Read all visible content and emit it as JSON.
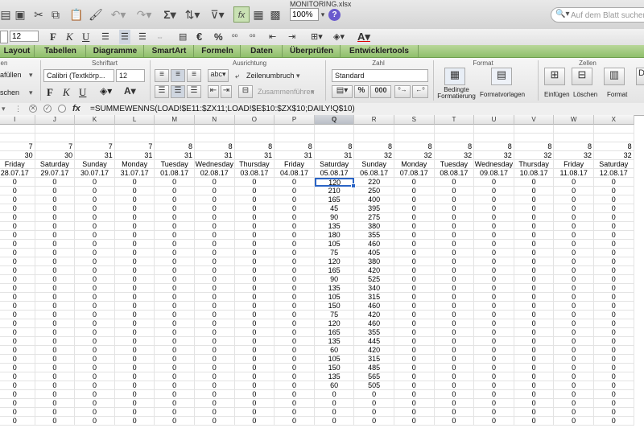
{
  "toolbar": {
    "title_fragment": "MONITORING.xlsx",
    "zoom_value": "100%",
    "search_placeholder": "Auf dem Blatt suchen"
  },
  "format_row": {
    "font_size": "12",
    "bold": "F",
    "italic": "K",
    "underline": "U"
  },
  "ribbon_tabs": [
    "Layout",
    "Tabellen",
    "Diagramme",
    "SmartArt",
    "Formeln",
    "Daten",
    "Überprüfen",
    "Entwicklertools"
  ],
  "ribbon": {
    "groups": {
      "edit_fragment": "en",
      "font": "Schriftart",
      "alignment": "Ausrichtung",
      "number": "Zahl",
      "format": "Format",
      "cells": "Zellen"
    },
    "fill_label": "afüllen",
    "clear_label": "schen",
    "font_name": "Calibri (Textkörp...",
    "font_size": "12",
    "wrap_text": "Zeilenumbruch",
    "merge": "Zusammenführen",
    "number_format": "Standard",
    "percent": "%",
    "thousands": "000",
    "cond_format": "Bedingte Formatierung",
    "cell_styles": "Formatvorlagen",
    "insert": "Einfügen",
    "delete": "Löschen",
    "format_btn": "Format"
  },
  "formula_bar": {
    "fx": "fx",
    "formula": "=SUMMEWENNS(LOAD!$E11:$ZX11;LOAD!$E$10:$ZX$10;DAILY!Q$10)"
  },
  "sheet": {
    "columns": [
      "I",
      "J",
      "K",
      "L",
      "M",
      "N",
      "O",
      "P",
      "Q",
      "R",
      "S",
      "T",
      "U",
      "V",
      "W",
      "X"
    ],
    "active_column": "Q",
    "row_months": [
      "7",
      "7",
      "7",
      "7",
      "8",
      "8",
      "8",
      "8",
      "8",
      "8",
      "8",
      "8",
      "8",
      "8",
      "8",
      "8"
    ],
    "row_weeks": [
      "30",
      "30",
      "31",
      "31",
      "31",
      "31",
      "31",
      "31",
      "31",
      "32",
      "32",
      "32",
      "32",
      "32",
      "32",
      "32"
    ],
    "row_days": [
      "Friday",
      "Saturday",
      "Sunday",
      "Monday",
      "Tuesday",
      "Wednesday",
      "Thursday",
      "Friday",
      "Saturday",
      "Sunday",
      "Monday",
      "Tuesday",
      "Wednesday",
      "Thursday",
      "Friday",
      "Saturday"
    ],
    "row_dates": [
      "28.07.17",
      "29.07.17",
      "30.07.17",
      "31.07.17",
      "01.08.17",
      "02.08.17",
      "03.08.17",
      "04.08.17",
      "05.08.17",
      "06.08.17",
      "07.08.17",
      "08.08.17",
      "09.08.17",
      "10.08.17",
      "11.08.17",
      "12.08.17"
    ],
    "q_values": [
      "120",
      "210",
      "165",
      "45",
      "90",
      "135",
      "180",
      "105",
      "75",
      "120",
      "165",
      "90",
      "135",
      "105",
      "150",
      "75",
      "120",
      "165",
      "135",
      "60",
      "105",
      "150",
      "135",
      "60",
      "0",
      "0",
      "0",
      "0"
    ],
    "r_values": [
      "220",
      "250",
      "400",
      "395",
      "275",
      "380",
      "355",
      "460",
      "405",
      "380",
      "420",
      "525",
      "340",
      "315",
      "460",
      "420",
      "460",
      "355",
      "445",
      "420",
      "315",
      "485",
      "565",
      "505",
      "0",
      "0",
      "0",
      "0"
    ],
    "other_value": "0"
  }
}
